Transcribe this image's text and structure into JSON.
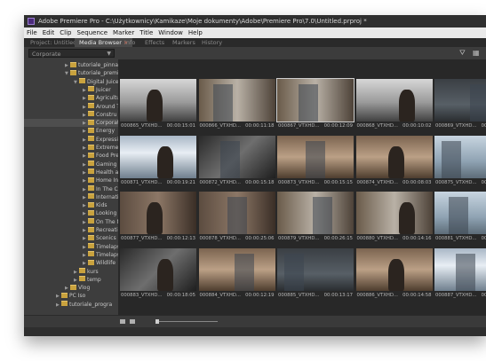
{
  "window": {
    "title": "Adobe Premiere Pro - C:\\Użytkownicy\\Kamikaze\\Moje dokumenty\\Adobe\\Premiere Pro\\7.0\\Untitled.prproj *"
  },
  "menu": [
    "File",
    "Edit",
    "Clip",
    "Sequence",
    "Marker",
    "Title",
    "Window",
    "Help"
  ],
  "tabs": [
    {
      "label": "Project: Untitled",
      "active": false
    },
    {
      "label": "Media Browser",
      "active": true,
      "close": "×"
    },
    {
      "label": "Info",
      "active": false
    },
    {
      "label": "Effects",
      "active": false
    },
    {
      "label": "Markers",
      "active": false
    },
    {
      "label": "History",
      "active": false
    }
  ],
  "location_dropdown": {
    "value": "Corporate"
  },
  "tree": [
    {
      "label": "tutoriale_pinnacl",
      "indent": 3,
      "arrow": "▶"
    },
    {
      "label": "tutoriale_premie",
      "indent": 3,
      "arrow": "▼"
    },
    {
      "label": "Digital Juice",
      "indent": 4,
      "arrow": "▼"
    },
    {
      "label": "Juicer",
      "indent": 5,
      "arrow": "▶"
    },
    {
      "label": "Agricultu",
      "indent": 5,
      "arrow": "▶"
    },
    {
      "label": "Around T",
      "indent": 5,
      "arrow": "▶"
    },
    {
      "label": "Constru",
      "indent": 5,
      "arrow": "▶"
    },
    {
      "label": "Corporat",
      "indent": 5,
      "arrow": "▶",
      "selected": true
    },
    {
      "label": "Energy",
      "indent": 5,
      "arrow": "▶"
    },
    {
      "label": "Expressi",
      "indent": 5,
      "arrow": "▶"
    },
    {
      "label": "Extreme",
      "indent": 5,
      "arrow": "▶"
    },
    {
      "label": "Food Pre",
      "indent": 5,
      "arrow": "▶"
    },
    {
      "label": "Gaming",
      "indent": 5,
      "arrow": "▶"
    },
    {
      "label": "Health a",
      "indent": 5,
      "arrow": "▶"
    },
    {
      "label": "Home In",
      "indent": 5,
      "arrow": "▶"
    },
    {
      "label": "In The C",
      "indent": 5,
      "arrow": "▶"
    },
    {
      "label": "Internati",
      "indent": 5,
      "arrow": "▶"
    },
    {
      "label": "Kids",
      "indent": 5,
      "arrow": "▶"
    },
    {
      "label": "Looking",
      "indent": 5,
      "arrow": "▶"
    },
    {
      "label": "On The M",
      "indent": 5,
      "arrow": "▶"
    },
    {
      "label": "Recreati",
      "indent": 5,
      "arrow": "▶"
    },
    {
      "label": "Scenics",
      "indent": 5,
      "arrow": "▶"
    },
    {
      "label": "Timelaps",
      "indent": 5,
      "arrow": "▶"
    },
    {
      "label": "Timelaps",
      "indent": 5,
      "arrow": "▶"
    },
    {
      "label": "Wildlife",
      "indent": 5,
      "arrow": "▶"
    },
    {
      "label": "kurs",
      "indent": 4,
      "arrow": "▶"
    },
    {
      "label": "temp",
      "indent": 4,
      "arrow": "▶"
    },
    {
      "label": "Vlog",
      "indent": 3,
      "arrow": "▶"
    },
    {
      "label": "PC Iso",
      "indent": 2,
      "arrow": "▶"
    },
    {
      "label": "tutoriale_progra",
      "indent": 2,
      "arrow": "▶"
    }
  ],
  "clips": [
    {
      "name": "000865_VTXHD...",
      "time": "00:00:15:01",
      "style": "a"
    },
    {
      "name": "000866_VTXHD...",
      "time": "00:00:11:18",
      "style": "b"
    },
    {
      "name": "000867_VTXHD...",
      "time": "00:00:12:09",
      "style": "b",
      "selected": true
    },
    {
      "name": "000868_VTXHD...",
      "time": "00:00:10:02",
      "style": "a"
    },
    {
      "name": "000869_VTXHD...",
      "time": "00:00:09:17",
      "style": "g"
    },
    {
      "name": "000870_VTXHD...",
      "time": "",
      "style": "h"
    },
    {
      "name": "000871_VTXHD...",
      "time": "00:00:19:21",
      "style": "f"
    },
    {
      "name": "000872_VTXHD...",
      "time": "00:00:15:18",
      "style": "d"
    },
    {
      "name": "000873_VTXHD...",
      "time": "00:00:15:15",
      "style": "e"
    },
    {
      "name": "000874_VTXHD...",
      "time": "00:00:08:03",
      "style": "e"
    },
    {
      "name": "000875_VTXHD...",
      "time": "00:00:05:16",
      "style": "c"
    },
    {
      "name": "000876_VTXHD...",
      "time": "",
      "style": "g"
    },
    {
      "name": "000877_VTXHD...",
      "time": "00:00:12:13",
      "style": "h"
    },
    {
      "name": "000878_VTXHD...",
      "time": "00:00:25:06",
      "style": "h"
    },
    {
      "name": "000879_VTXHD...",
      "time": "00:00:26:15",
      "style": "b"
    },
    {
      "name": "000880_VTXHD...",
      "time": "00:00:14:16",
      "style": "b"
    },
    {
      "name": "000881_VTXHD...",
      "time": "00:00:14:16",
      "style": "c"
    },
    {
      "name": "000882_VTXHD...",
      "time": "",
      "style": "d"
    },
    {
      "name": "000883_VTXHD...",
      "time": "00:00:18:05",
      "style": "d"
    },
    {
      "name": "000884_VTXHD...",
      "time": "00:00:12:19",
      "style": "e"
    },
    {
      "name": "000885_VTXHD...",
      "time": "00:00:13:17",
      "style": "g"
    },
    {
      "name": "000886_VTXHD...",
      "time": "00:00:14:58",
      "style": "e"
    },
    {
      "name": "000887_VTXHD...",
      "time": "00:00:12:16",
      "style": "f"
    },
    {
      "name": "000888_VTXHD...",
      "time": "",
      "style": "f"
    }
  ],
  "icons": {
    "filter": "filter-icon",
    "view": "view-icon",
    "list_view": "list-view-icon",
    "icon_view": "icon-view-icon"
  }
}
